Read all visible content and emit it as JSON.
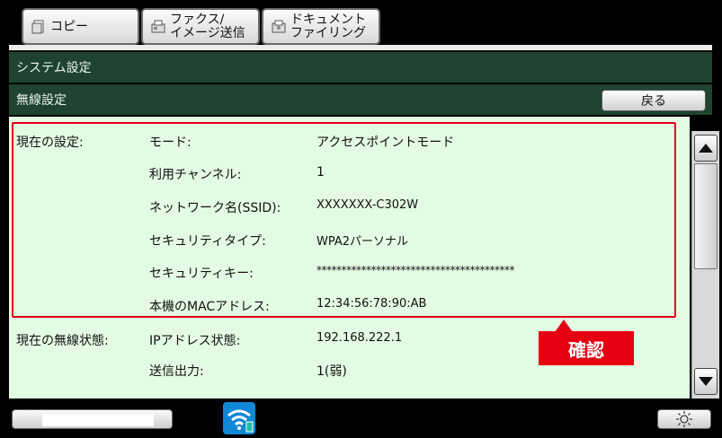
{
  "tabs": [
    {
      "label": "コピー",
      "icon": "copy-icon"
    },
    {
      "label": "ファクス/\nイメージ送信",
      "icon": "fax-icon"
    },
    {
      "label": "ドキュメント\nファイリング",
      "icon": "document-filing-icon"
    }
  ],
  "header": {
    "title": "システム設定",
    "subtitle": "無線設定",
    "back_label": "戻る"
  },
  "sections": {
    "current_settings_label": "現在の設定:",
    "wireless_status_label": "現在の無線状態:"
  },
  "settings": [
    {
      "label": "モード:",
      "value": "アクセスポイントモード"
    },
    {
      "label": "利用チャンネル:",
      "value": "1"
    },
    {
      "label": "ネットワーク名(SSID):",
      "value": "XXXXXXX-C302W"
    },
    {
      "label": "セキュリティタイプ:",
      "value": "WPA2パーソナル"
    },
    {
      "label": "セキュリティキー:",
      "value": "****************************************"
    },
    {
      "label": "本機のMACアドレス:",
      "value": "12:34:56:78:90:AB"
    }
  ],
  "status": [
    {
      "label": "IPアドレス状態:",
      "value": "192.168.222.1"
    },
    {
      "label": "送信出力:",
      "value": "1(弱)"
    }
  ],
  "callout": {
    "label": "確認",
    "color": "#e60012"
  },
  "colors": {
    "header_bg": "#1e4431",
    "content_bg": "#e4fbe3",
    "wifi": "#0e88d6"
  },
  "icons": {
    "scroll_up": "triangle-up-icon",
    "scroll_down": "triangle-down-icon",
    "wifi": "wifi-icon",
    "brightness": "brightness-icon"
  }
}
